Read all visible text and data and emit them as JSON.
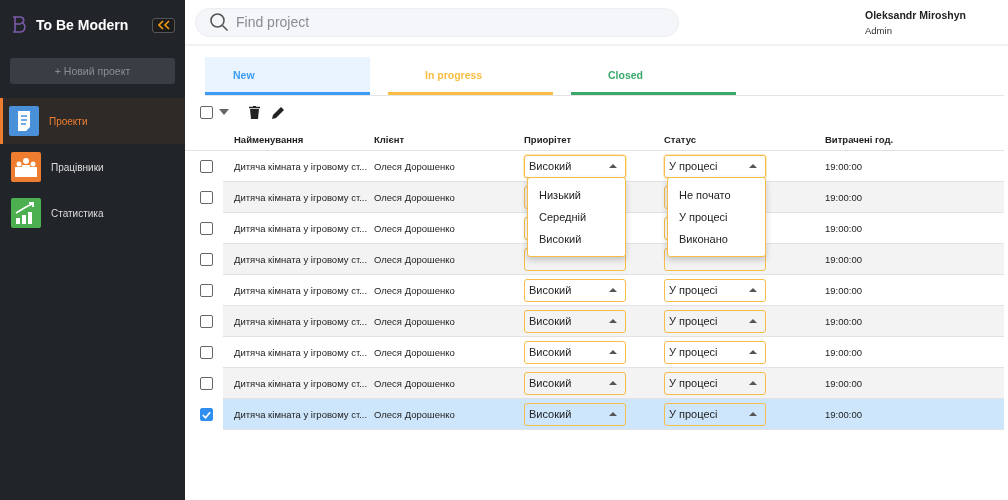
{
  "brand": {
    "name": "To Be Modern"
  },
  "sidebar": {
    "new_button": "+ Новий проект",
    "items": [
      {
        "label": "Проекти",
        "selected": true
      },
      {
        "label": "Працівники",
        "selected": false
      },
      {
        "label": "Статистика",
        "selected": false
      }
    ]
  },
  "search": {
    "placeholder": "Find project"
  },
  "user": {
    "name": "Oleksandr Miroshyn",
    "role": "Admin"
  },
  "select_all": {
    "checked": false
  },
  "tabs": [
    {
      "label": "New",
      "selected": true,
      "color": "#3d9bf5"
    },
    {
      "label": "In progress",
      "selected": false,
      "color": "#f7bd44"
    },
    {
      "label": "Closed",
      "selected": false,
      "color": "#3aa86b"
    }
  ],
  "table": {
    "columns": [
      "Найменування",
      "Клієнт",
      "Приорітет",
      "Статус",
      "Витрачені год."
    ],
    "rows": [
      {
        "name": "Дитяча кімната у ігровому ст...",
        "client": "Олеся Дорошенко",
        "priority": "Високий",
        "status": "У процесі",
        "hours": "19:00:00",
        "checked": false,
        "selected": false,
        "menus_open": true
      },
      {
        "name": "Дитяча кімната у ігровому ст...",
        "client": "Олеся Дорошенко",
        "hours": "19:00:00",
        "checked": false,
        "selected": false,
        "menus_open": false
      },
      {
        "name": "Дитяча кімната у ігровому ст...",
        "client": "Олеся Дорошенко",
        "hours": "19:00:00",
        "checked": false,
        "selected": false,
        "menus_open": false
      },
      {
        "name": "Дитяча кімната у ігровому ст...",
        "client": "Олеся Дорошенко",
        "hours": "19:00:00",
        "checked": false,
        "selected": false,
        "menus_open": false
      },
      {
        "name": "Дитяча кімната у ігровому ст...",
        "client": "Олеся Дорошенко",
        "priority": "Високий",
        "status": "У процесі",
        "hours": "19:00:00",
        "checked": false,
        "selected": false,
        "menus_open": false
      },
      {
        "name": "Дитяча кімната у ігровому ст...",
        "client": "Олеся Дорошенко",
        "priority": "Високий",
        "status": "У процесі",
        "hours": "19:00:00",
        "checked": false,
        "selected": false,
        "menus_open": false
      },
      {
        "name": "Дитяча кімната у ігровому ст...",
        "client": "Олеся Дорошенко",
        "priority": "Високий",
        "status": "У процесі",
        "hours": "19:00:00",
        "checked": false,
        "selected": false,
        "menus_open": false
      },
      {
        "name": "Дитяча кімната у ігровому ст...",
        "client": "Олеся Дорошенко",
        "priority": "Високий",
        "status": "У процесі",
        "hours": "19:00:00",
        "checked": false,
        "selected": false,
        "menus_open": false
      },
      {
        "name": "Дитяча кімната у ігровому ст...",
        "client": "Олеся Дорошенко",
        "priority": "Високий",
        "status": "У процесі",
        "hours": "19:00:00",
        "checked": true,
        "selected": true,
        "menus_open": false
      }
    ],
    "priority_options": [
      "Низький",
      "Середній",
      "Високий"
    ],
    "status_options": [
      "Не почато",
      "У процесі",
      "Виконано"
    ]
  }
}
